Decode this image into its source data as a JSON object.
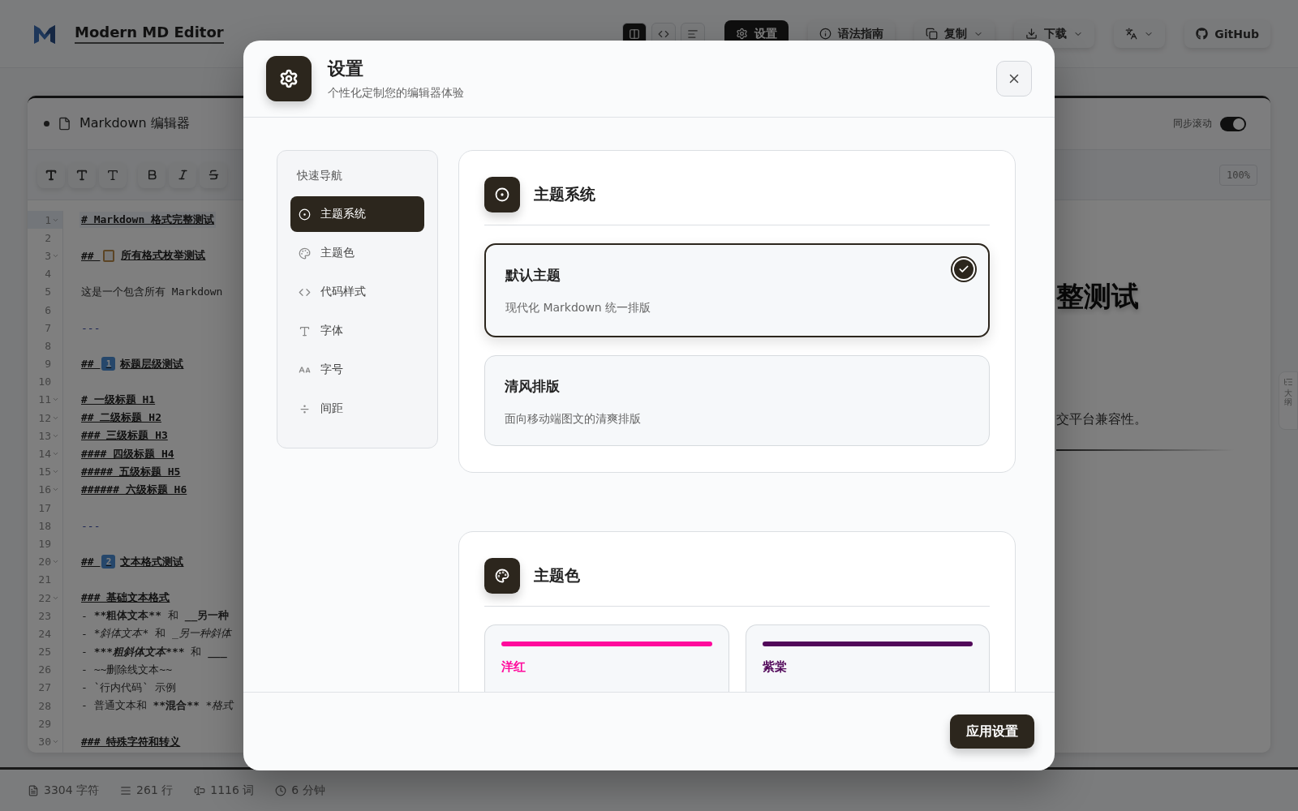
{
  "app": {
    "title": "Modern MD Editor"
  },
  "view_modes": [
    {
      "kind": "split",
      "selected": true
    },
    {
      "kind": "code",
      "selected": false
    },
    {
      "kind": "preview",
      "selected": false
    }
  ],
  "actions": [
    {
      "kind": "settings",
      "label": "设置",
      "selected": true,
      "dropdown": false
    },
    {
      "kind": "guide",
      "label": "语法指南",
      "selected": false,
      "dropdown": false
    },
    {
      "kind": "copy",
      "label": "复制",
      "selected": false,
      "dropdown": true
    },
    {
      "kind": "download",
      "label": "下载",
      "selected": false,
      "dropdown": true
    },
    {
      "kind": "translate",
      "selected": false,
      "dropdown": true
    },
    {
      "kind": "github",
      "label": "GitHub",
      "selected": false,
      "dropdown": false
    }
  ],
  "editor": {
    "title": "Markdown 编辑器",
    "sync_scroll": {
      "label": "同步滚动",
      "on": true
    },
    "zoom": "100%",
    "format_buttons": [
      {
        "kind": "heading1"
      },
      {
        "kind": "heading2"
      },
      {
        "kind": "heading3"
      },
      {
        "kind": "bold"
      },
      {
        "kind": "italic"
      },
      {
        "kind": "strike"
      }
    ],
    "lines": [
      {
        "number": "1",
        "kind": "heading",
        "foldable": true,
        "active": true,
        "segments": [
          {
            "text": "# Markdown 格式完整测试",
            "kind": "plain"
          }
        ]
      },
      {
        "number": "2",
        "kind": "blank",
        "foldable": false,
        "active": false
      },
      {
        "number": "3",
        "kind": "heading",
        "foldable": true,
        "active": false,
        "segments": [
          {
            "text": "## ",
            "kind": "plain"
          }
        ],
        "badge": {
          "kind": "clipboard"
        },
        "rest": "所有格式枚举测试"
      },
      {
        "number": "4",
        "kind": "blank",
        "foldable": false,
        "active": false
      },
      {
        "number": "5",
        "kind": "text",
        "foldable": false,
        "active": false,
        "segments": [
          {
            "text": "这是一个包含所有 Markdown",
            "kind": "plain"
          }
        ]
      },
      {
        "number": "6",
        "kind": "blank",
        "foldable": false,
        "active": false
      },
      {
        "number": "7",
        "kind": "rule",
        "foldable": false,
        "active": false,
        "segments": [
          {
            "text": "---",
            "kind": "plain"
          }
        ]
      },
      {
        "number": "8",
        "kind": "blank",
        "foldable": false,
        "active": false
      },
      {
        "number": "9",
        "kind": "heading",
        "foldable": false,
        "active": false,
        "segments": [
          {
            "text": "## ",
            "kind": "plain"
          }
        ],
        "badge": {
          "kind": "keycap",
          "label": "1"
        },
        "rest": "标题层级测试"
      },
      {
        "number": "10",
        "kind": "blank",
        "foldable": false,
        "active": false
      },
      {
        "number": "11",
        "kind": "heading",
        "foldable": true,
        "active": false,
        "segments": [
          {
            "text": "# 一级标题 H1",
            "kind": "plain"
          }
        ]
      },
      {
        "number": "12",
        "kind": "heading",
        "foldable": true,
        "active": false,
        "segments": [
          {
            "text": "## 二级标题 H2",
            "kind": "plain"
          }
        ]
      },
      {
        "number": "13",
        "kind": "heading",
        "foldable": true,
        "active": false,
        "segments": [
          {
            "text": "### 三级标题 H3",
            "kind": "plain"
          }
        ]
      },
      {
        "number": "14",
        "kind": "heading",
        "foldable": true,
        "active": false,
        "segments": [
          {
            "text": "#### 四级标题 H4",
            "kind": "plain"
          }
        ]
      },
      {
        "number": "15",
        "kind": "heading",
        "foldable": true,
        "active": false,
        "segments": [
          {
            "text": "##### 五级标题 H5",
            "kind": "plain"
          }
        ]
      },
      {
        "number": "16",
        "kind": "heading",
        "foldable": true,
        "active": false,
        "segments": [
          {
            "text": "###### 六级标题 H6",
            "kind": "plain"
          }
        ]
      },
      {
        "number": "17",
        "kind": "blank",
        "foldable": false,
        "active": false
      },
      {
        "number": "18",
        "kind": "rule",
        "foldable": false,
        "active": false,
        "segments": [
          {
            "text": "---",
            "kind": "plain"
          }
        ]
      },
      {
        "number": "19",
        "kind": "blank",
        "foldable": false,
        "active": false
      },
      {
        "number": "20",
        "kind": "heading",
        "foldable": true,
        "active": false,
        "segments": [
          {
            "text": "## ",
            "kind": "plain"
          }
        ],
        "badge": {
          "kind": "keycap",
          "label": "2"
        },
        "rest": "文本格式测试"
      },
      {
        "number": "21",
        "kind": "blank",
        "foldable": false,
        "active": false
      },
      {
        "number": "22",
        "kind": "heading",
        "foldable": true,
        "active": false,
        "segments": [
          {
            "text": "### 基础文本格式",
            "kind": "plain"
          }
        ]
      },
      {
        "number": "23",
        "kind": "text",
        "foldable": false,
        "active": false,
        "segments": [
          {
            "text": "- ",
            "kind": "plain"
          },
          {
            "text": "**粗体文本**",
            "kind": "bold"
          },
          {
            "text": " 和 ",
            "kind": "plain"
          },
          {
            "text": "__另一种",
            "kind": "bold"
          }
        ]
      },
      {
        "number": "24",
        "kind": "text",
        "foldable": false,
        "active": false,
        "segments": [
          {
            "text": "- ",
            "kind": "plain"
          },
          {
            "text": "*斜体文本*",
            "kind": "italic"
          },
          {
            "text": " 和 ",
            "kind": "plain"
          },
          {
            "text": "_另一种斜体",
            "kind": "italic"
          }
        ]
      },
      {
        "number": "25",
        "kind": "text",
        "foldable": false,
        "active": false,
        "segments": [
          {
            "text": "- ",
            "kind": "plain"
          },
          {
            "text": "***粗斜体文本***",
            "kind": "bolditalic"
          },
          {
            "text": " 和 ",
            "kind": "plain"
          },
          {
            "text": "___",
            "kind": "bold"
          }
        ]
      },
      {
        "number": "26",
        "kind": "text",
        "foldable": false,
        "active": false,
        "segments": [
          {
            "text": "- ~~删除线文本~~",
            "kind": "plain"
          }
        ]
      },
      {
        "number": "27",
        "kind": "text",
        "foldable": false,
        "active": false,
        "segments": [
          {
            "text": "- `行内代码` 示例",
            "kind": "plain"
          }
        ]
      },
      {
        "number": "28",
        "kind": "text",
        "foldable": false,
        "active": false,
        "segments": [
          {
            "text": "- 普通文本和 ",
            "kind": "plain"
          },
          {
            "text": "**混合**",
            "kind": "bold"
          },
          {
            "text": " *格式",
            "kind": "italic"
          }
        ]
      },
      {
        "number": "29",
        "kind": "blank",
        "foldable": false,
        "active": false
      },
      {
        "number": "30",
        "kind": "heading",
        "foldable": true,
        "active": false,
        "segments": [
          {
            "text": "### 特殊字符和转义",
            "kind": "plain"
          }
        ]
      }
    ]
  },
  "preview": {
    "heading": "整测试",
    "paragraph": "交平台兼容性。"
  },
  "outline_tab": {
    "label": "大纲"
  },
  "status_bar": [
    {
      "kind": "chars",
      "text": "3304 字符"
    },
    {
      "kind": "lines",
      "text": "261 行"
    },
    {
      "kind": "words",
      "text": "1116 词"
    },
    {
      "kind": "time",
      "text": "6 分钟"
    }
  ],
  "dialog": {
    "title": "设置",
    "subtitle": "个性化定制您的编辑器体验",
    "nav": {
      "title": "快速导航",
      "items": [
        {
          "kind": "theme",
          "label": "主题系统",
          "selected": true
        },
        {
          "kind": "palette",
          "label": "主题色",
          "selected": false
        },
        {
          "kind": "code",
          "label": "代码样式",
          "selected": false
        },
        {
          "kind": "font",
          "label": "字体",
          "selected": false
        },
        {
          "kind": "size",
          "label": "字号",
          "selected": false
        },
        {
          "kind": "spacing",
          "label": "间距",
          "selected": false
        }
      ]
    },
    "sections": [
      {
        "kind": "themes",
        "title": "主题系统",
        "options": [
          {
            "name": "默认主题",
            "description": "现代化 Markdown 统一排版",
            "selected": true
          },
          {
            "name": "清风排版",
            "description": "面向移动端图文的清爽排版",
            "selected": false
          }
        ]
      },
      {
        "kind": "colors",
        "title": "主题色",
        "colors": [
          {
            "name": "洋红",
            "color": "#ff0a9c"
          },
          {
            "name": "紫棠",
            "color": "#52095a"
          }
        ]
      }
    ],
    "apply_button": "应用设置"
  }
}
